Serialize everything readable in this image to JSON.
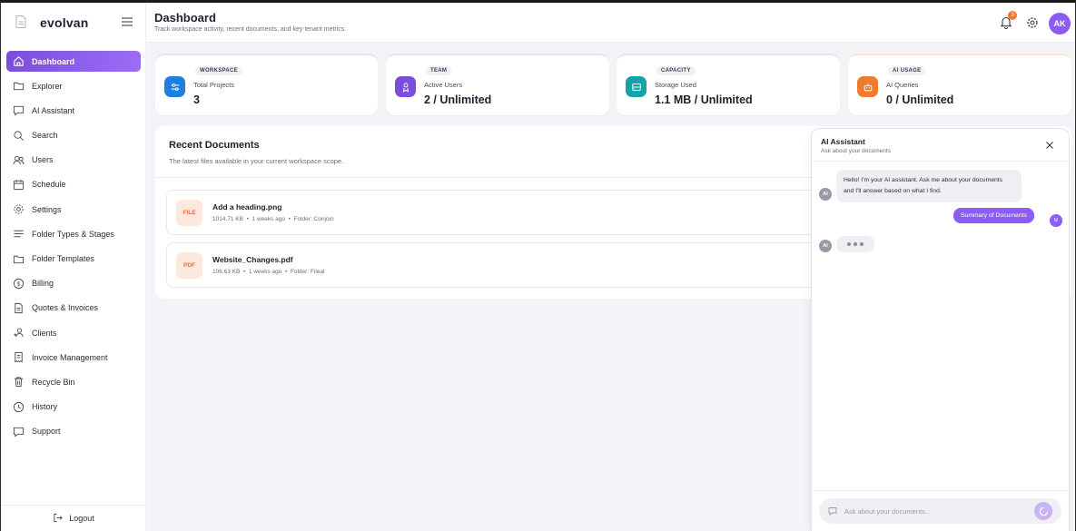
{
  "brand": {
    "name": "evolvan"
  },
  "header": {
    "title": "Dashboard",
    "subtitle": "Track workspace activity, recent documents, and key tenant metrics.",
    "notification_count": "3",
    "avatar_initials": "AK"
  },
  "sidebar": {
    "items": [
      {
        "label": "Dashboard",
        "icon": "home-icon"
      },
      {
        "label": "Explorer",
        "icon": "folder-icon"
      },
      {
        "label": "AI Assistant",
        "icon": "chat-icon"
      },
      {
        "label": "Search",
        "icon": "search-icon"
      },
      {
        "label": "Users",
        "icon": "users-icon"
      },
      {
        "label": "Schedule",
        "icon": "calendar-icon"
      },
      {
        "label": "Settings",
        "icon": "gear-icon"
      },
      {
        "label": "Folder Types & Stages",
        "icon": "list-icon"
      },
      {
        "label": "Folder Templates",
        "icon": "folder-icon"
      },
      {
        "label": "Billing",
        "icon": "dollar-icon"
      },
      {
        "label": "Quotes & Invoices",
        "icon": "document-icon"
      },
      {
        "label": "Clients",
        "icon": "clients-icon"
      },
      {
        "label": "Invoice Management",
        "icon": "invoice-icon"
      },
      {
        "label": "Recycle Bin",
        "icon": "trash-icon"
      },
      {
        "label": "History",
        "icon": "clock-icon"
      },
      {
        "label": "Support",
        "icon": "chat-icon"
      }
    ],
    "active": "Dashboard",
    "logout_label": "Logout"
  },
  "stats": [
    {
      "tag": "WORKSPACE",
      "label": "Total Projects",
      "value": "3",
      "color": "#1e7fe0"
    },
    {
      "tag": "TEAM",
      "label": "Active Users",
      "value": "2 / Unlimited",
      "color": "#7c4ddc"
    },
    {
      "tag": "CAPACITY",
      "label": "Storage Used",
      "value": "1.1 MB / Unlimited",
      "color": "#14a3a8"
    },
    {
      "tag": "AI USAGE",
      "label": "AI Queries",
      "value": "0 / Unlimited",
      "color": "#f07a2e"
    }
  ],
  "recent_documents": {
    "title": "Recent Documents",
    "subtitle": "The latest files available in your current workspace scope.",
    "items": [
      {
        "type": "FILE",
        "name": "Add a heading.png",
        "size": "1014.71 KB",
        "age": "1 weeks ago",
        "folder": "Folder: Conjoin"
      },
      {
        "type": "PDF",
        "name": "Website_Changes.pdf",
        "size": "106.63 KB",
        "age": "1 weeks ago",
        "folder": "Folder: Fileal"
      }
    ]
  },
  "ai_panel": {
    "title": "AI Assistant",
    "subtitle": "Ask about your documents",
    "ai_badge": "AI",
    "user_badge": "U",
    "greeting": "Hello! I'm your AI assistant. Ask me about your documents and I'll answer based on what I find.",
    "user_message": "Summary of Documents",
    "input_placeholder": "Ask about your documents..."
  },
  "colors": {
    "accent": "#8b5cf6",
    "badge": "#f07a2e"
  }
}
